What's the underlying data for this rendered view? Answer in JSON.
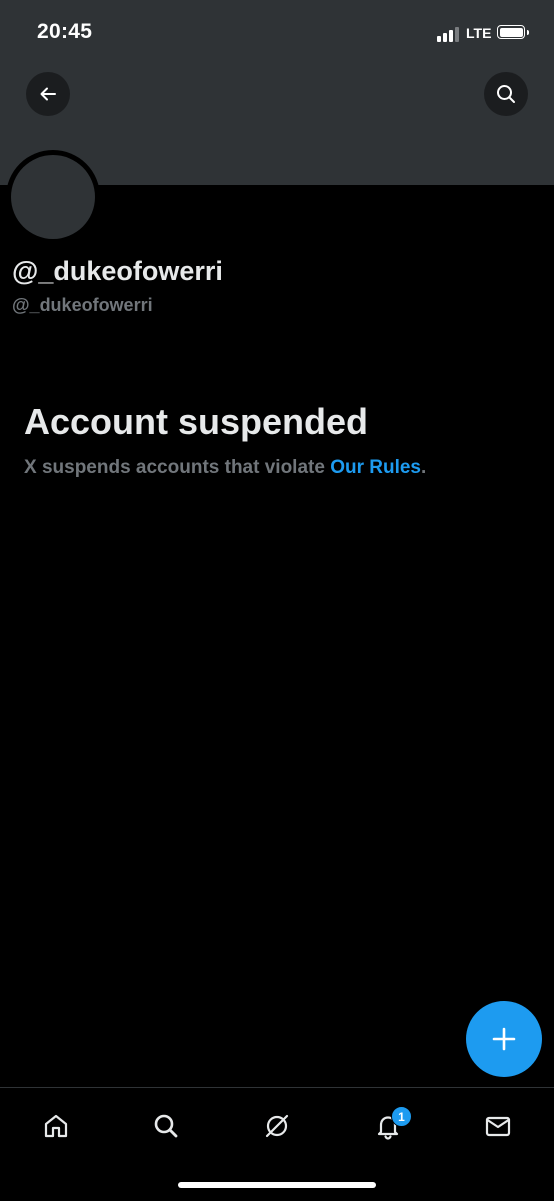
{
  "status_bar": {
    "time": "20:45",
    "network": "LTE",
    "signal_bars_active": 3,
    "signal_bars_total": 4
  },
  "header": {
    "back_icon": "arrow-left-icon",
    "search_icon": "search-icon"
  },
  "profile": {
    "display_name": "@_dukeofowerri",
    "handle": "@_dukeofowerri"
  },
  "suspension": {
    "title": "Account suspended",
    "description": "X suspends accounts that violate ",
    "link_text": "Our Rules",
    "trailing": "."
  },
  "fab": {
    "icon": "plus-icon"
  },
  "bottom_nav": {
    "items": [
      {
        "icon": "home-icon"
      },
      {
        "icon": "search-icon"
      },
      {
        "icon": "grok-icon"
      },
      {
        "icon": "notifications-icon",
        "badge": "1"
      },
      {
        "icon": "messages-icon"
      }
    ]
  },
  "colors": {
    "accent": "#1d9bf0",
    "banner": "#2f3336",
    "background": "#000000",
    "secondary_text": "#71767b"
  }
}
